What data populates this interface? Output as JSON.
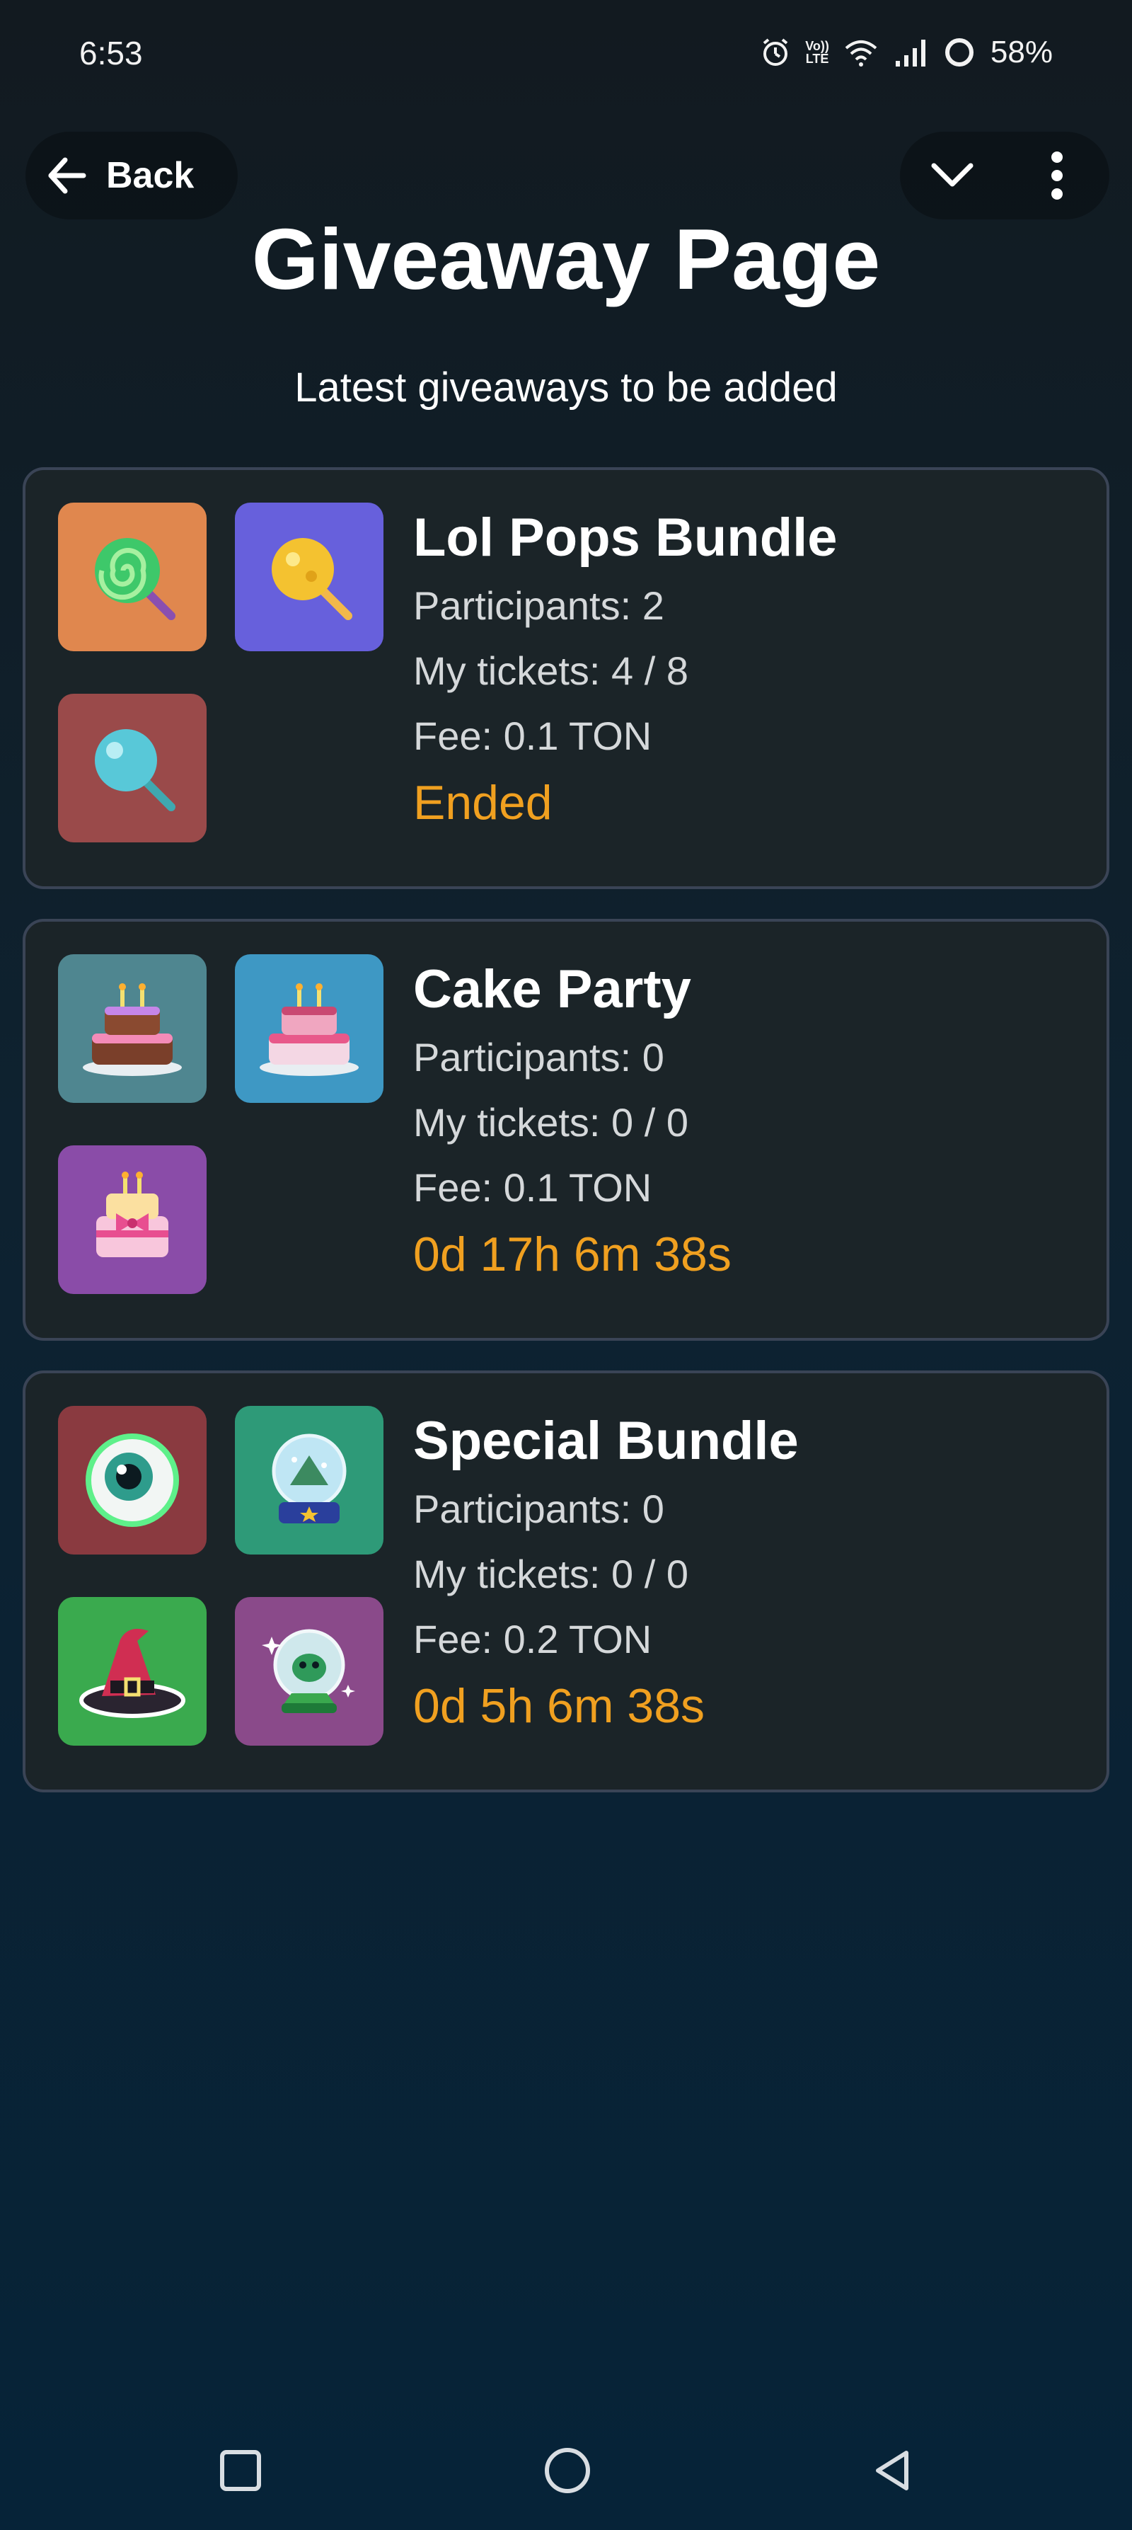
{
  "status_bar": {
    "time": "6:53",
    "battery": "58%",
    "volte_top": "Vo))",
    "volte_bottom": "LTE",
    "icons": [
      "alarm-icon",
      "volte-icon",
      "wifi-icon",
      "signal-icon",
      "battery-ring-icon"
    ]
  },
  "header": {
    "back_label": "Back",
    "title": "Giveaway Page",
    "subtitle": "Latest giveaways to be added",
    "menu_icons": [
      "chevron-down-icon",
      "more-vertical-icon"
    ]
  },
  "giveaways": [
    {
      "title": "Lol Pops Bundle",
      "participants": "Participants: 2",
      "tickets": "My tickets: 4 / 8",
      "fee": "Fee: 0.1 TON",
      "status": "Ended",
      "items": [
        "swirl-lollipop",
        "golden-lollipop",
        "blue-lollipop"
      ]
    },
    {
      "title": "Cake Party",
      "participants": "Participants: 0",
      "tickets": "My tickets: 0 / 0",
      "fee": "Fee: 0.1 TON",
      "status": "0d 17h 6m 38s",
      "items": [
        "chocolate-cake",
        "pastel-cake",
        "gift-cake"
      ]
    },
    {
      "title": "Special Bundle",
      "participants": "Participants: 0",
      "tickets": "My tickets: 0 / 0",
      "fee": "Fee: 0.2 TON",
      "status": "0d 5h 6m 38s",
      "items": [
        "eyeball",
        "snow-globe",
        "witch-hat",
        "crystal-ball"
      ]
    }
  ],
  "colors": {
    "accent_status": "#f0a020",
    "card_bg": "#1b2428",
    "card_border": "#3a4456"
  },
  "nav_bar": {
    "icons": [
      "recents-square-icon",
      "home-circle-icon",
      "back-triangle-icon"
    ]
  }
}
